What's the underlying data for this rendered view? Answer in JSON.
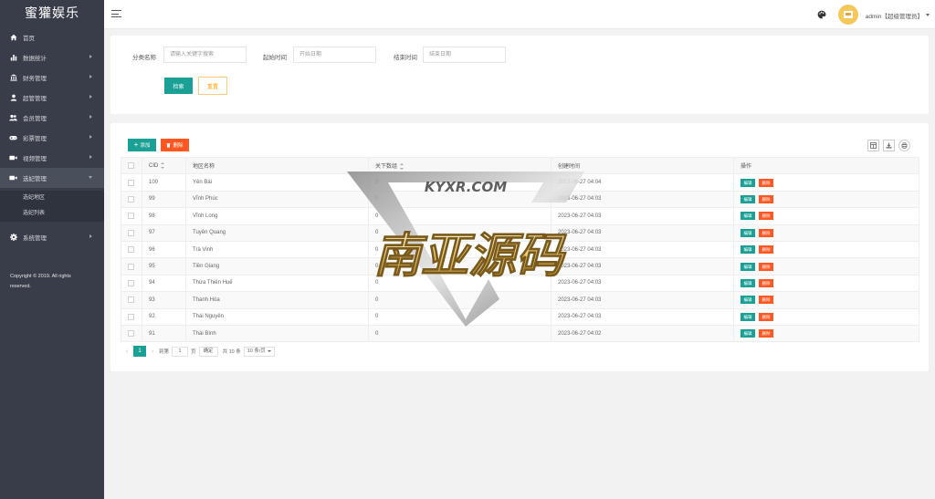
{
  "sidebar": {
    "brand": "蜜獾娱乐",
    "items": [
      {
        "label": "首页",
        "icon": "home-icon",
        "has_arrow": false
      },
      {
        "label": "数据统计",
        "icon": "bar-chart-icon",
        "has_arrow": true
      },
      {
        "label": "财务管理",
        "icon": "bank-icon",
        "has_arrow": true
      },
      {
        "label": "超管管理",
        "icon": "user-icon",
        "has_arrow": true
      },
      {
        "label": "会员管理",
        "icon": "users-icon",
        "has_arrow": true
      },
      {
        "label": "彩票管理",
        "icon": "gamepad-icon",
        "has_arrow": true
      },
      {
        "label": "视频管理",
        "icon": "video-icon",
        "has_arrow": true
      },
      {
        "label": "选妃管理",
        "icon": "video-icon",
        "has_arrow": true,
        "open": true
      },
      {
        "label": "系统管理",
        "icon": "gear-icon",
        "has_arrow": true
      }
    ],
    "submenu": [
      "选妃地区",
      "选妃列表"
    ],
    "copyright_line1": "Copyright © 2019. All rights",
    "copyright_line2": "reserved."
  },
  "header": {
    "user_name": "admin【超级管理员】"
  },
  "search": {
    "category_label": "分类名称",
    "category_placeholder": "请输入关键字搜索",
    "start_label": "起始时间",
    "start_placeholder": "开始日期",
    "end_label": "结束时间",
    "end_placeholder": "结束日期",
    "search_button": "检索",
    "reset_button": "重置"
  },
  "toolbar": {
    "add_button": "添加",
    "delete_button": "删除"
  },
  "table": {
    "columns": [
      "CID",
      "地区名称",
      "关下数组",
      "创建时间",
      "操作"
    ],
    "edit_label": "编辑",
    "delete_label": "删除",
    "rows": [
      {
        "cid": "100",
        "name": "Yên Bái",
        "count": "0",
        "created": "2023-06-27 04:04"
      },
      {
        "cid": "99",
        "name": "Vĩnh Phúc",
        "count": "0",
        "created": "2023-06-27 04:03"
      },
      {
        "cid": "98",
        "name": "Vĩnh Long",
        "count": "0",
        "created": "2023-06-27 04:03"
      },
      {
        "cid": "97",
        "name": "Tuyên Quang",
        "count": "0",
        "created": "2023-06-27 04:03"
      },
      {
        "cid": "96",
        "name": "Trà Vinh",
        "count": "0",
        "created": "2023-06-27 04:03"
      },
      {
        "cid": "95",
        "name": "Tiền Giang",
        "count": "0",
        "created": "2023-06-27 04:03"
      },
      {
        "cid": "94",
        "name": "Thừa Thiên Huế",
        "count": "0",
        "created": "2023-06-27 04:03"
      },
      {
        "cid": "93",
        "name": "Thanh Hóa",
        "count": "0",
        "created": "2023-06-27 04:03"
      },
      {
        "cid": "92",
        "name": "Thái Nguyên",
        "count": "0",
        "created": "2023-06-27 04:03"
      },
      {
        "cid": "91",
        "name": "Thái Bình",
        "count": "0",
        "created": "2023-06-27 04:02"
      }
    ]
  },
  "pagination": {
    "current_page": "1",
    "goto_label": "到第",
    "goto_value": "1",
    "page_unit": "页",
    "confirm_label": "确定",
    "total_label": "共 10 条",
    "page_size": "10 条/页"
  },
  "watermark": {
    "url_text": "KYXR.COM",
    "main_text": "南亚源码"
  },
  "colors": {
    "sidebar_bg": "#393d49",
    "primary_green": "#1aa094",
    "danger_orange": "#ff5722",
    "warn_outline": "#ffcb7a"
  }
}
